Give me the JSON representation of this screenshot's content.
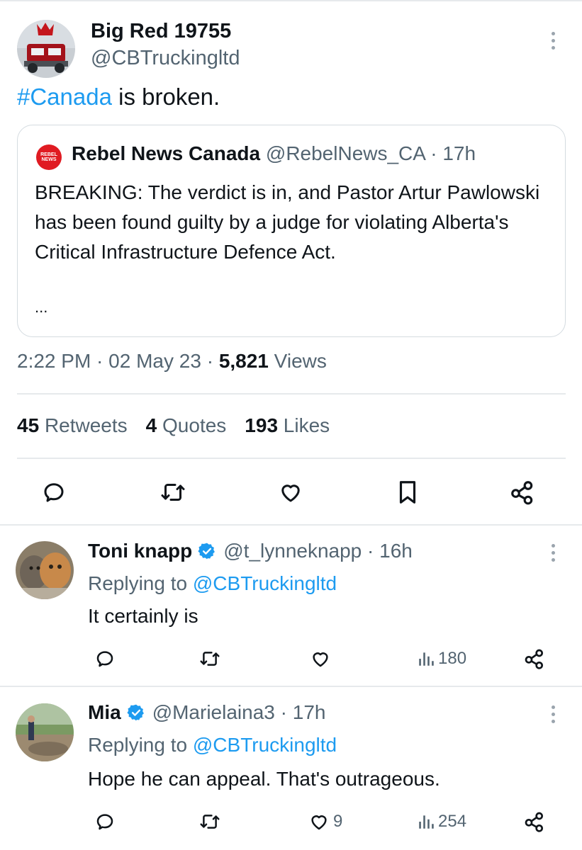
{
  "tweet": {
    "author_name": "Big Red 19755",
    "author_handle": "@CBTruckingltd",
    "hashtag": "#Canada",
    "text_rest": " is broken.",
    "quote": {
      "logo_text": "REBEL NEWS CANADA",
      "name": "Rebel News Canada",
      "handle": "@RebelNews_CA",
      "time": "17h",
      "text": "BREAKING: The verdict is in, and Pastor Artur Pawlowski has been found guilty by a judge for violating Alberta's Critical Infrastructure Defence Act.",
      "ellipsis": "..."
    },
    "time": "2:22 PM",
    "date": "02 May 23",
    "views_count": "5,821",
    "views_label": "Views",
    "retweets_count": "45",
    "retweets_label": "Retweets",
    "quotes_count": "4",
    "quotes_label": "Quotes",
    "likes_count": "193",
    "likes_label": "Likes"
  },
  "actions_icons": [
    "reply-icon",
    "retweet-icon",
    "like-icon",
    "bookmark-icon",
    "share-icon"
  ],
  "replies": [
    {
      "name": "Toni knapp",
      "handle": "@t_lynneknapp",
      "time": "16h",
      "replying_prefix": "Replying to",
      "replying_to": "@CBTruckingltd",
      "text": "It certainly is",
      "likes": "",
      "views": "180"
    },
    {
      "name": "Mia",
      "handle": "@Marielaina3",
      "time": "17h",
      "replying_prefix": "Replying to",
      "replying_to": "@CBTruckingltd",
      "text": "Hope he can appeal. That's outrageous.",
      "likes": "9",
      "views": "254"
    }
  ],
  "colors": {
    "link": "#1d9bf0",
    "muted": "#536471",
    "text": "#0f1419",
    "verified": "#1d9bf0",
    "brand_red": "#e01b22"
  }
}
